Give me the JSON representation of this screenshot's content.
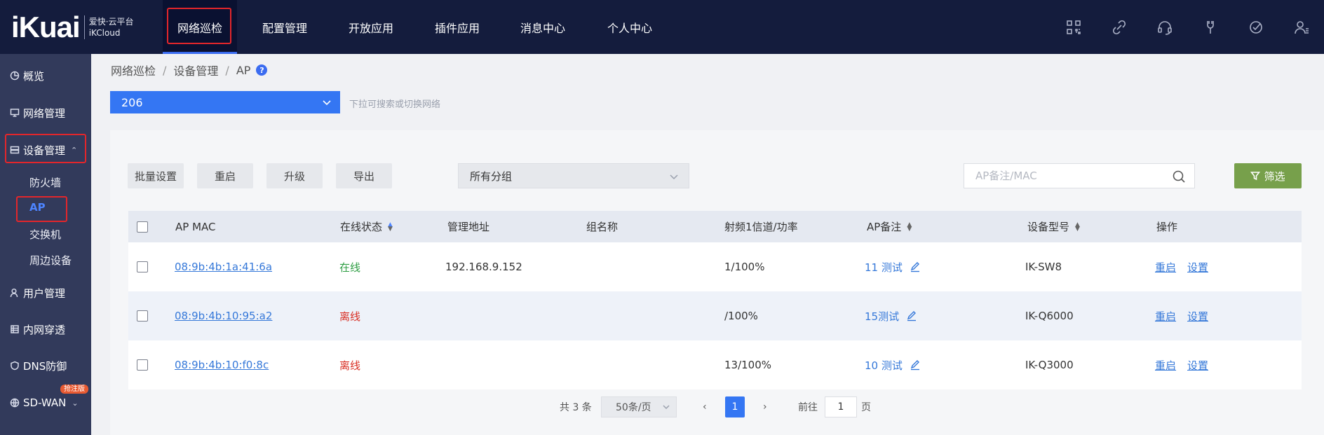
{
  "brand": {
    "logo": "iKuai",
    "name_cn": "爱快·云平台",
    "name_en": "iKCloud"
  },
  "topnav": {
    "items": [
      {
        "label": "网络巡检",
        "active": true
      },
      {
        "label": "配置管理"
      },
      {
        "label": "开放应用"
      },
      {
        "label": "插件应用"
      },
      {
        "label": "消息中心"
      },
      {
        "label": "个人中心"
      }
    ],
    "icons": [
      "grid-icon",
      "link-icon",
      "headset-icon",
      "bulb-icon",
      "check-circle-icon",
      "user-icon"
    ]
  },
  "sidebar": {
    "items": [
      {
        "label": "概览",
        "icon": "pie-icon"
      },
      {
        "label": "网络管理",
        "icon": "monitor-icon"
      },
      {
        "label": "设备管理",
        "icon": "device-icon",
        "expanded": true
      },
      {
        "label": "用户管理",
        "icon": "user-icon"
      },
      {
        "label": "内网穿透",
        "icon": "tunnel-icon"
      },
      {
        "label": "DNS防御",
        "icon": "shield-icon"
      },
      {
        "label": "SD-WAN",
        "icon": "globe-icon",
        "badge": "抢注版"
      }
    ],
    "sub_items": [
      {
        "label": "防火墙"
      },
      {
        "label": "AP",
        "active": true
      },
      {
        "label": "交换机"
      },
      {
        "label": "周边设备"
      }
    ]
  },
  "breadcrumb": [
    "网络巡检",
    "设备管理",
    "AP"
  ],
  "network": {
    "selected": "206",
    "hint": "下拉可搜索或切换网络"
  },
  "toolbar": {
    "batch": "批量设置",
    "restart": "重启",
    "upgrade": "升级",
    "export": "导出",
    "group": "所有分组",
    "search_placeholder": "AP备注/MAC",
    "filter": "筛选"
  },
  "table": {
    "headers": {
      "mac": "AP MAC",
      "status": "在线状态",
      "addr": "管理地址",
      "group": "组名称",
      "radio": "射频1信道/功率",
      "note": "AP备注",
      "model": "设备型号",
      "ops": "操作"
    },
    "rows": [
      {
        "mac": "08:9b:4b:1a:41:6a",
        "status": "在线",
        "online": true,
        "addr": "192.168.9.152",
        "group": "",
        "radio": "1/100%",
        "note": "11 测试",
        "model": "IK-SW8",
        "op1": "重启",
        "op2": "设置"
      },
      {
        "mac": "08:9b:4b:10:95:a2",
        "status": "离线",
        "online": false,
        "addr": "",
        "group": "",
        "radio": "/100%",
        "note": "15测试",
        "model": "IK-Q6000",
        "op1": "重启",
        "op2": "设置"
      },
      {
        "mac": "08:9b:4b:10:f0:8c",
        "status": "离线",
        "online": false,
        "addr": "",
        "group": "",
        "radio": "13/100%",
        "note": "10 测试",
        "model": "IK-Q3000",
        "op1": "重启",
        "op2": "设置"
      }
    ]
  },
  "pagination": {
    "total": "共 3 条",
    "page_size": "50条/页",
    "current": "1",
    "goto_label": "前往",
    "goto_value": "1",
    "page_unit": "页"
  }
}
